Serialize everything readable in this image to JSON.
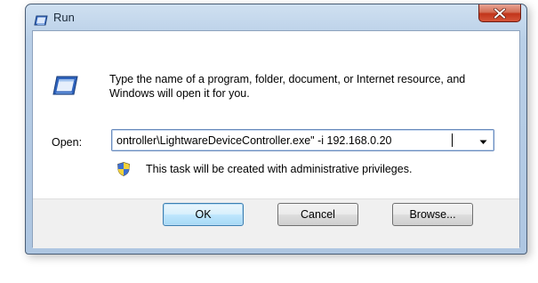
{
  "window": {
    "title": "Run"
  },
  "dialog": {
    "description": "Type the name of a program, folder, document, or Internet resource, and Windows will open it for you.",
    "open_label": "Open:",
    "open_value": "ontroller\\LightwareDeviceController.exe\" -i 192.168.0.20",
    "admin_notice": "This task will be created with administrative privileges."
  },
  "buttons": {
    "ok": "OK",
    "cancel": "Cancel",
    "browse": "Browse..."
  },
  "icons": {
    "title": "run-icon",
    "close": "close-icon",
    "dialog": "run-icon",
    "dropdown": "chevron-down-icon",
    "admin": "uac-shield-icon"
  },
  "colors": {
    "frame": "#aec6e1",
    "close_button": "#c2351a",
    "default_button_border": "#3c7fb1"
  }
}
